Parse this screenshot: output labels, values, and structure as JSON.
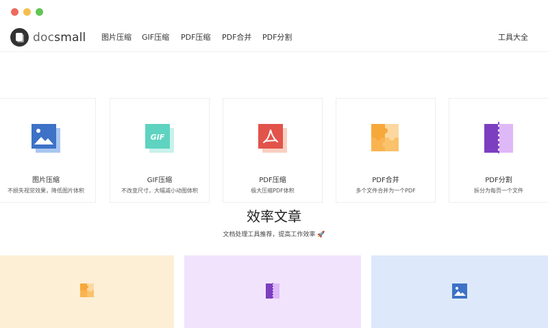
{
  "window": {
    "controls": [
      "close",
      "minimize",
      "maximize"
    ]
  },
  "navbar": {
    "logo_text_a": "doc",
    "logo_text_b": "small",
    "items": [
      "图片压缩",
      "GIF压缩",
      "PDF压缩",
      "PDF合并",
      "PDF分割"
    ],
    "right_link": "工具大全"
  },
  "tools": [
    {
      "name": "图片压缩",
      "desc": "不损失视觉效果，降低图片体积",
      "icon": "image-icon",
      "color": "#3d72c6"
    },
    {
      "name": "GIF压缩",
      "desc": "不改变尺寸，大幅减小动图体积",
      "icon": "gif-icon",
      "color": "#5ed3c0"
    },
    {
      "name": "PDF压缩",
      "desc": "极大压缩PDF体积",
      "icon": "pdf-icon",
      "color": "#e2534b"
    },
    {
      "name": "PDF合并",
      "desc": "多个文件合并为一个PDF",
      "icon": "puzzle-icon",
      "color": "#f7a83b"
    },
    {
      "name": "PDF分割",
      "desc": "拆分为每页一个文件",
      "icon": "split-icon",
      "color": "#7c3fbf"
    }
  ],
  "articles": {
    "title": "效率文章",
    "subtitle": "文档处理工具推荐，提高工作效率",
    "subtitle_emoji": "🚀",
    "cards": [
      {
        "bg": "#fdeed6",
        "icon": "puzzle-icon"
      },
      {
        "bg": "#f1e3fc",
        "icon": "split-icon"
      },
      {
        "bg": "#dde9fb",
        "icon": "image-icon"
      }
    ]
  }
}
